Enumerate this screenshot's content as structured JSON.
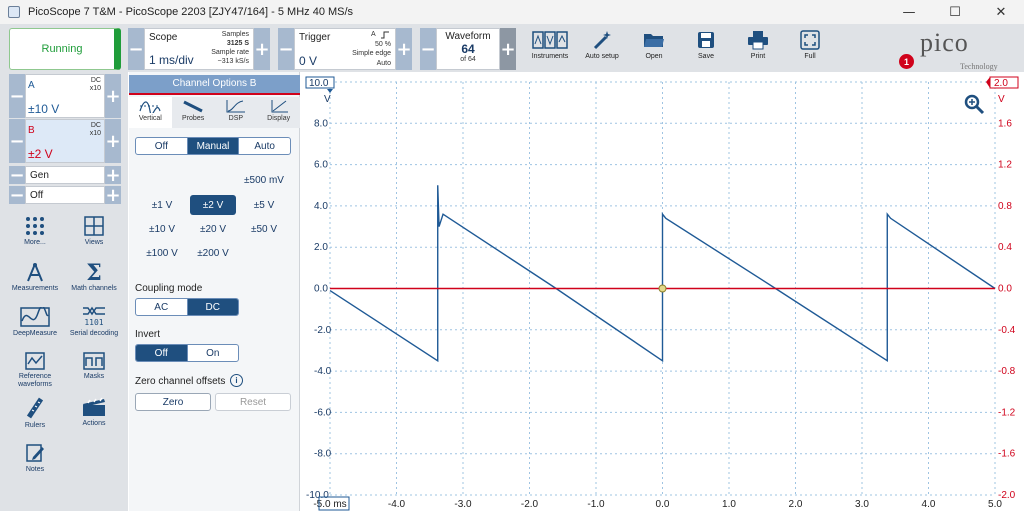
{
  "window": {
    "title": "PicoScope 7 T&M  - PicoScope 2203 [ZJY47/164] - 5 MHz 40 MS/s",
    "minimize": "—",
    "maximize": "☐",
    "close": "✕"
  },
  "run": {
    "label": "Running"
  },
  "scope_group": {
    "label": "Scope",
    "value": "1 ms/div",
    "samples_label": "Samples",
    "samples": "3125 S",
    "rate_label": "Sample rate",
    "rate": "~313 kS/s"
  },
  "trigger_group": {
    "label": "Trigger",
    "value": "0 V",
    "channel": "A",
    "edge_icon": "rising-edge-icon",
    "percent": "50 %",
    "type": "Simple edge",
    "mode": "Auto"
  },
  "waveform_group": {
    "label": "Waveform",
    "value": "64",
    "of": "of 64"
  },
  "tools": [
    {
      "label": "Instruments",
      "icon": "instruments-icon"
    },
    {
      "label": "Auto setup",
      "icon": "wand-icon"
    },
    {
      "label": "Open",
      "icon": "folder-icon"
    },
    {
      "label": "Save",
      "icon": "save-icon"
    },
    {
      "label": "Print",
      "icon": "printer-icon"
    },
    {
      "label": "Full",
      "icon": "fullscreen-icon"
    }
  ],
  "notification_count": "1",
  "brand": {
    "name": "pico",
    "sub": "Technology"
  },
  "channels": [
    {
      "name": "A",
      "coupling": "DC",
      "probe": "x10",
      "range": "±10 V",
      "color": "#1f5a96"
    },
    {
      "name": "B",
      "coupling": "DC",
      "probe": "x10",
      "range": "±2 V",
      "color": "#d0021b"
    }
  ],
  "gen": {
    "label": "Gen",
    "state": "Off"
  },
  "side_items": [
    {
      "label": "More...",
      "icon": "grid-dots-icon"
    },
    {
      "label": "Views",
      "icon": "views-icon"
    },
    {
      "label": "Measurements",
      "icon": "caliper-icon"
    },
    {
      "label": "Math channels",
      "icon": "sigma-icon"
    },
    {
      "label": "DeepMeasure",
      "icon": "deepmeasure-icon"
    },
    {
      "label": "Serial decoding",
      "icon": "serial-decoding-icon"
    },
    {
      "label": "Reference waveforms",
      "icon": "reference-waveform-icon"
    },
    {
      "label": "Masks",
      "icon": "masks-icon"
    },
    {
      "label": "Rulers",
      "icon": "ruler-icon"
    },
    {
      "label": "Actions",
      "icon": "clapper-icon"
    },
    {
      "label": "Notes",
      "icon": "notes-icon"
    }
  ],
  "options": {
    "title": "Channel Options",
    "channel": "B",
    "tabs": [
      {
        "label": "Vertical"
      },
      {
        "label": "Probes"
      },
      {
        "label": "DSP"
      },
      {
        "label": "Display"
      }
    ],
    "mode": [
      "Off",
      "Manual",
      "Auto"
    ],
    "mode_selected": "Manual",
    "ranges": [
      "±500 mV",
      "±1 V",
      "±2 V",
      "±5 V",
      "±10 V",
      "±20 V",
      "±50 V",
      "±100 V",
      "±200 V"
    ],
    "range_selected": "±2 V",
    "coupling_label": "Coupling mode",
    "coupling": [
      "AC",
      "DC"
    ],
    "coupling_selected": "DC",
    "invert_label": "Invert",
    "invert": [
      "Off",
      "On"
    ],
    "invert_selected": "Off",
    "zero_label": "Zero channel offsets",
    "zero": "Zero",
    "reset": "Reset",
    "info_icon": "i"
  },
  "chart_data": {
    "type": "line",
    "x_unit": "ms",
    "xlim": [
      -5.0,
      5.0
    ],
    "x_ticks": [
      "-5.0",
      "-4.0",
      "-3.0",
      "-2.0",
      "-1.0",
      "0.0",
      "1.0",
      "2.0",
      "3.0",
      "4.0",
      "5.0"
    ],
    "left_axis": {
      "unit": "V",
      "ylim": [
        -10,
        10
      ],
      "ticks": [
        "10.0",
        "8.0",
        "6.0",
        "4.0",
        "2.0",
        "0.0",
        "-2.0",
        "-4.0",
        "-6.0",
        "-8.0",
        "-10.0"
      ],
      "color": "#1f5a96"
    },
    "right_axis": {
      "unit": "V",
      "ylim": [
        -2,
        2
      ],
      "ticks": [
        "2.0",
        "1.6",
        "1.2",
        "0.8",
        "0.4",
        "0.0",
        "-0.4",
        "-0.8",
        "-1.2",
        "-1.6",
        "-2.0"
      ],
      "color": "#d0021b"
    },
    "grid": true,
    "series": [
      {
        "channel": "A",
        "axis": "left",
        "color": "#1f5a96",
        "x": [
          -5.0,
          -3.38,
          -3.38,
          -3.36,
          -3.3,
          -1.6,
          0.0,
          0.0,
          0.05,
          1.7,
          3.38,
          3.38,
          3.43,
          5.0
        ],
        "y": [
          -0.1,
          -3.5,
          5.0,
          3.0,
          3.6,
          0.0,
          -3.5,
          3.6,
          3.4,
          0.0,
          -3.5,
          3.6,
          3.4,
          0.0
        ]
      },
      {
        "channel": "B",
        "axis": "right",
        "color": "#d0021b",
        "x": [
          -5.0,
          5.0
        ],
        "y": [
          0.0,
          0.0
        ]
      }
    ],
    "trigger_marker": {
      "x": 0.0,
      "y": 0.0
    }
  }
}
